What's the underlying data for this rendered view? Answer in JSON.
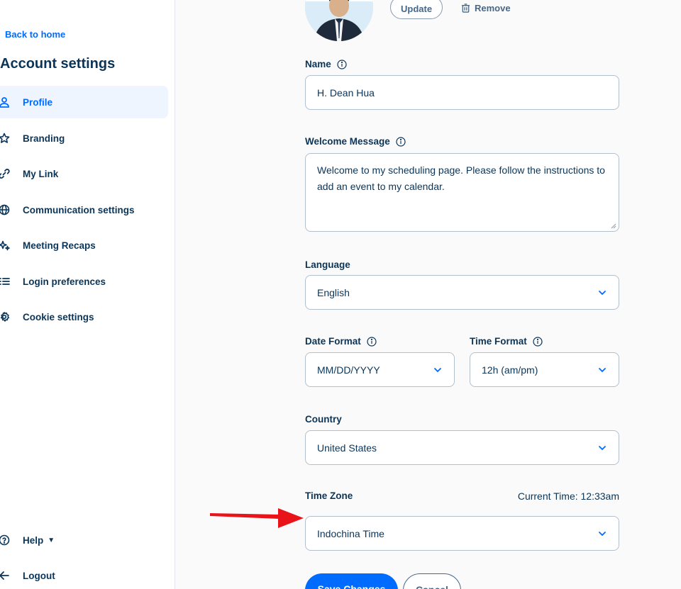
{
  "sidebar": {
    "back_label": "Back to home",
    "title": "Account settings",
    "items": [
      {
        "label": "Profile",
        "icon": "user-icon",
        "active": true
      },
      {
        "label": "Branding",
        "icon": "star-icon"
      },
      {
        "label": "My Link",
        "icon": "link-icon"
      },
      {
        "label": "Communication settings",
        "icon": "globe-icon"
      },
      {
        "label": "Meeting Recaps",
        "icon": "sparkle-icon"
      },
      {
        "label": "Login preferences",
        "icon": "list-icon"
      },
      {
        "label": "Cookie settings",
        "icon": "gear-icon"
      }
    ],
    "help_label": "Help",
    "logout_label": "Logout"
  },
  "profile": {
    "update_label": "Update",
    "remove_label": "Remove",
    "name": {
      "label": "Name",
      "value": "H. Dean Hua"
    },
    "welcome": {
      "label": "Welcome Message",
      "value": "Welcome to my scheduling page. Please follow the instructions to add an event to my calendar."
    },
    "language": {
      "label": "Language",
      "value": "English"
    },
    "date_format": {
      "label": "Date Format",
      "value": "MM/DD/YYYY"
    },
    "time_format": {
      "label": "Time Format",
      "value": "12h (am/pm)"
    },
    "country": {
      "label": "Country",
      "value": "United States"
    },
    "time_zone": {
      "label": "Time Zone",
      "value": "Indochina Time"
    },
    "current_time": "Current Time:  12:33am",
    "save_label": "Save Changes",
    "cancel_label": "Cancel"
  },
  "colors": {
    "accent": "#006bff",
    "text": "#0b3558",
    "arrow": "#e8141a"
  }
}
